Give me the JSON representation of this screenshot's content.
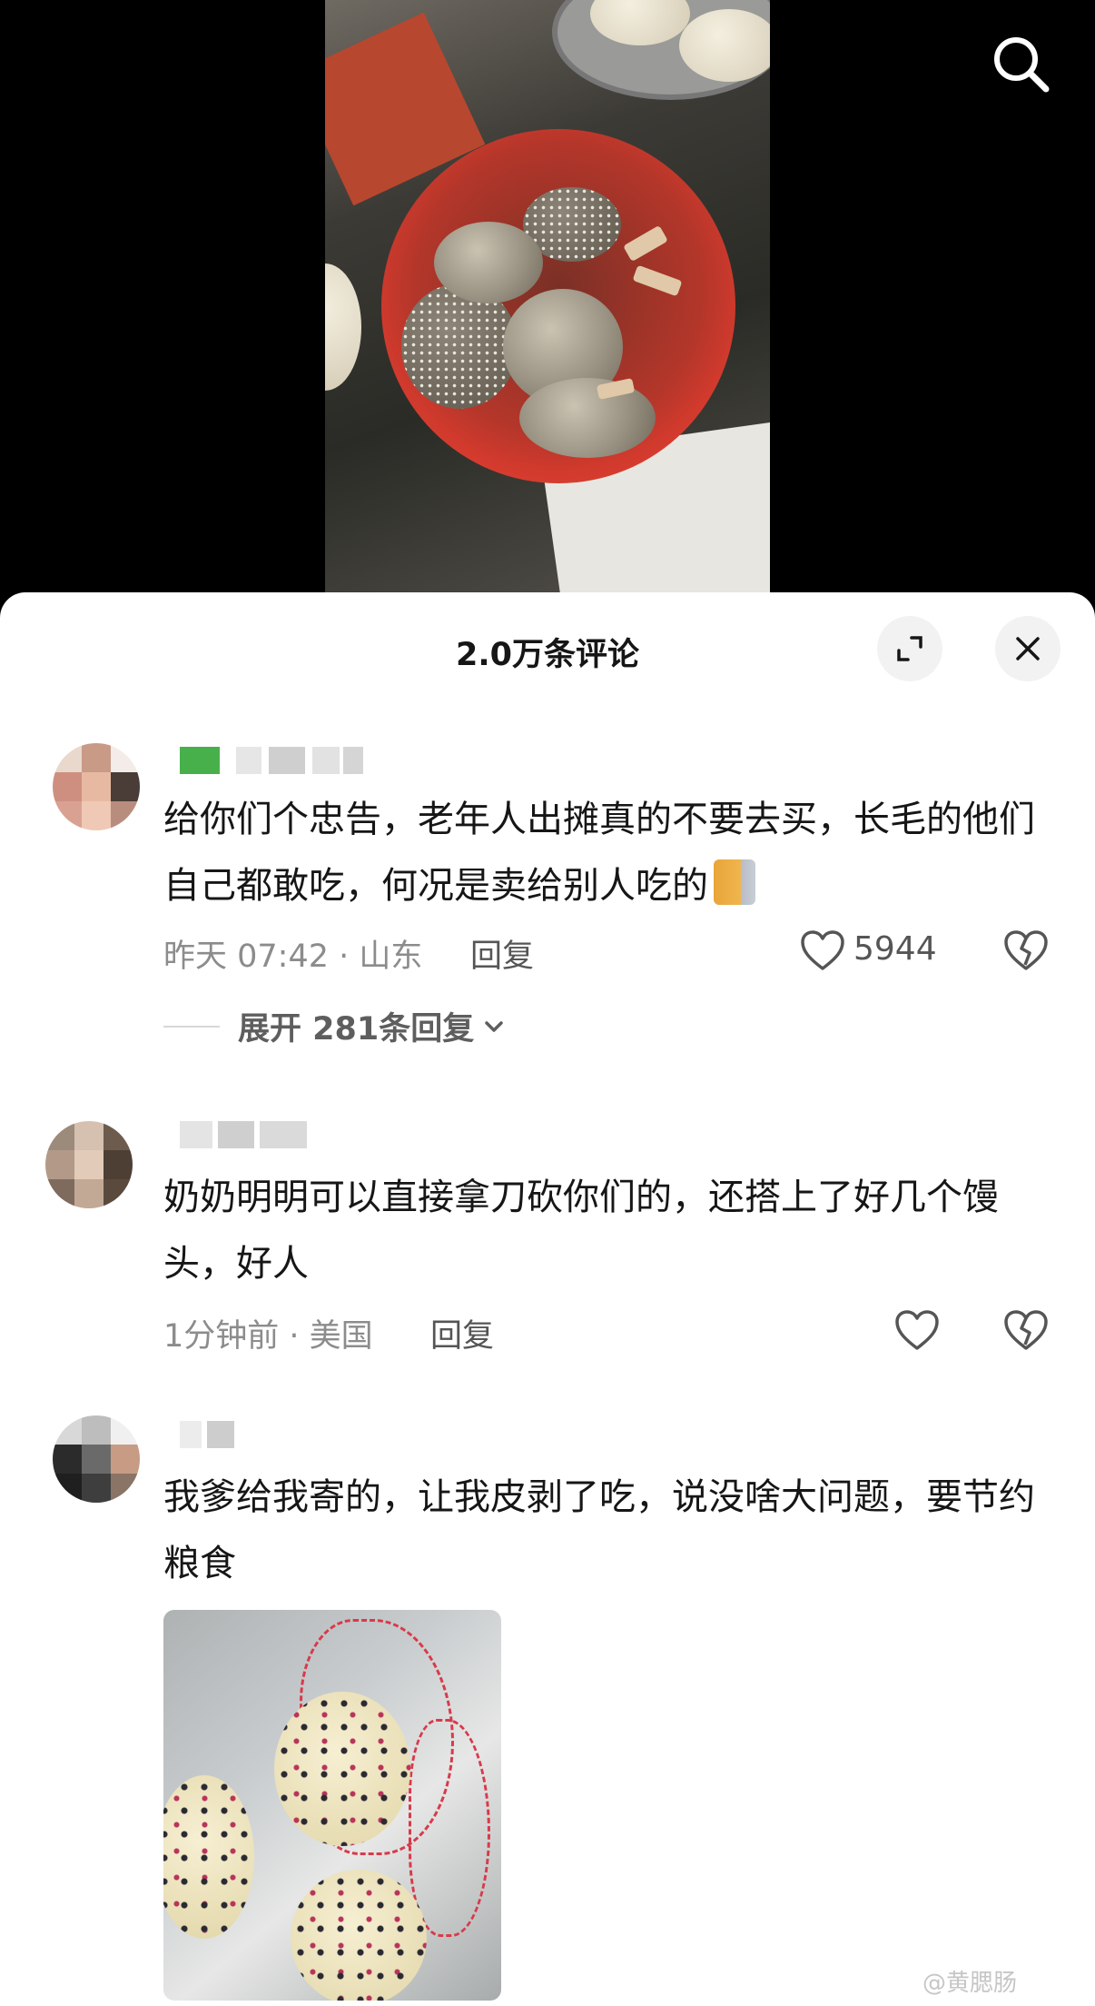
{
  "header": {
    "search_icon": "search-icon"
  },
  "sheet": {
    "title": "2.0万条评论",
    "expand_icon": "expand-icon",
    "close_icon": "close-icon"
  },
  "comments": [
    {
      "text": "给你们个忠告，老年人出摊真的不要去买，长毛的他们自己都敢吃，何况是卖给别人吃的",
      "emoji": "cat-emoji",
      "time": "昨天 07:42",
      "location": "山东",
      "meta": "昨天 07:42 · 山东",
      "reply_label": "回复",
      "likes": "5944",
      "expand_replies": "展开 281条回复"
    },
    {
      "text": "奶奶明明可以直接拿刀砍你们的，还搭上了好几个馒头，好人",
      "time": "1分钟前",
      "location": "美国",
      "meta": "1分钟前 · 美国",
      "reply_label": "回复"
    },
    {
      "text": "我爹给我寄的，让我皮剥了吃，说没啥大问题，要节约粮食"
    }
  ],
  "watermark": "@黄腮肠",
  "colors": {
    "accent_text": "#161616",
    "muted_text": "#8c8c8c",
    "sheet_bg": "#ffffff"
  }
}
